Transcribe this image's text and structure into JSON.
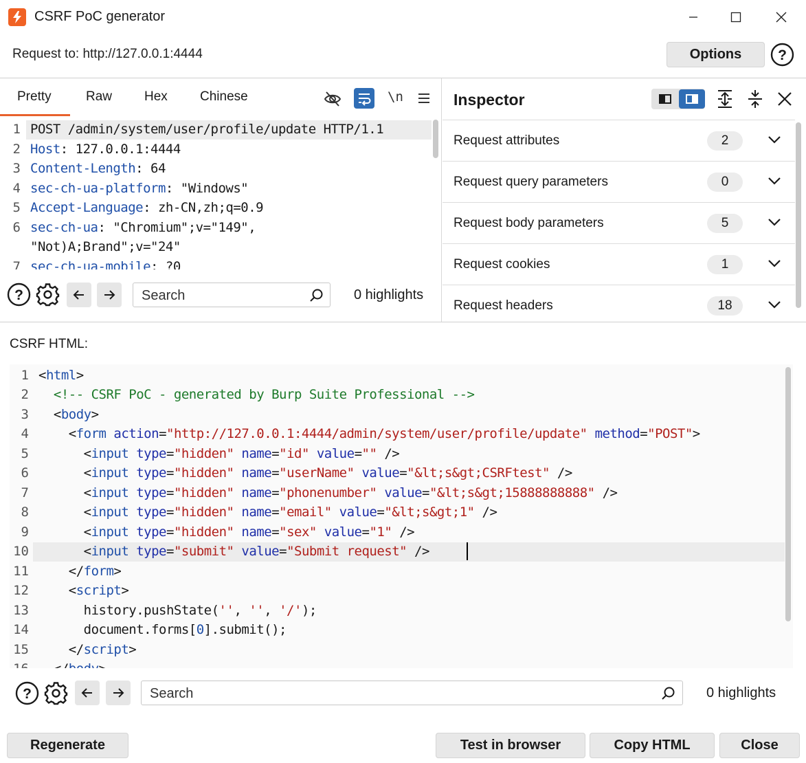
{
  "window": {
    "title": "CSRF PoC generator"
  },
  "request": {
    "label": "Request to: http://127.0.0.1:4444",
    "options_label": "Options"
  },
  "editor_tabs": [
    "Pretty",
    "Raw",
    "Hex",
    "Chinese"
  ],
  "active_tab": "Pretty",
  "request_editor": {
    "line_numbers": [
      "1",
      "2",
      "3",
      "4",
      "5",
      "6",
      "",
      "7"
    ],
    "lines": [
      {
        "key": "POST /admin/system/user/profile/update HTTP/1.1",
        "val": ""
      },
      {
        "key": "Host",
        "val": ": 127.0.0.1:4444"
      },
      {
        "key": "Content-Length",
        "val": ": 64"
      },
      {
        "key": "sec-ch-ua-platform",
        "val": ": \"Windows\""
      },
      {
        "key": "Accept-Language",
        "val": ": zh-CN,zh;q=0.9"
      },
      {
        "key": "sec-ch-ua",
        "val": ": \"Chromium\";v=\"149\","
      },
      {
        "key": "",
        "val": "\"Not)A;Brand\";v=\"24\""
      },
      {
        "key": "sec-ch-ua-mobile",
        "val": ": ?0"
      }
    ]
  },
  "search_top": {
    "placeholder": "Search",
    "highlights": "0 highlights"
  },
  "inspector": {
    "title": "Inspector",
    "sections": [
      {
        "label": "Request attributes",
        "count": "2"
      },
      {
        "label": "Request query parameters",
        "count": "0"
      },
      {
        "label": "Request body parameters",
        "count": "5"
      },
      {
        "label": "Request cookies",
        "count": "1"
      },
      {
        "label": "Request headers",
        "count": "18"
      }
    ]
  },
  "csrf": {
    "label": "CSRF HTML:",
    "line_numbers": [
      "1",
      "2",
      "3",
      "4",
      "5",
      "6",
      "7",
      "8",
      "9",
      "10",
      "11",
      "12",
      "13",
      "14",
      "15",
      "16"
    ]
  },
  "search_bottom": {
    "placeholder": "Search",
    "highlights": "0 highlights"
  },
  "buttons": {
    "regenerate": "Regenerate",
    "test_in_browser": "Test in browser",
    "copy_html": "Copy HTML",
    "close": "Close"
  },
  "colors": {
    "accent": "#e8612c",
    "header_key": "#1f4fa8",
    "string": "#b0201c",
    "comment": "#1d7a2a"
  }
}
